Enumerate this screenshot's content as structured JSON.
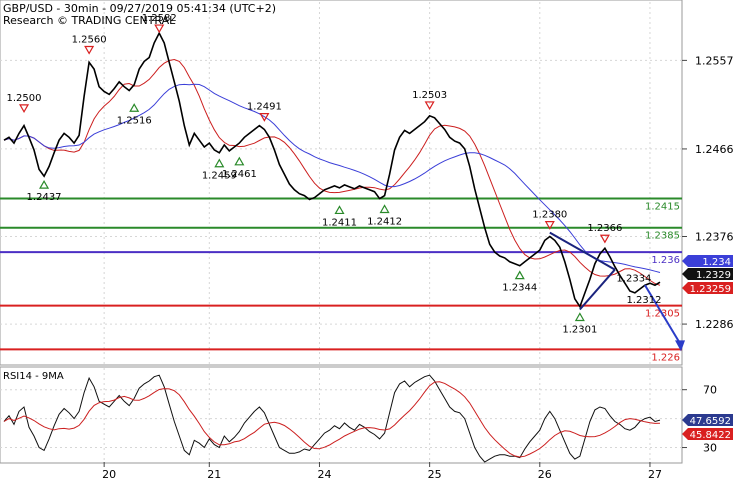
{
  "header": {
    "line1": "GBP/USD - 30min - 09/27/2019 05:41:34 (UTC+2)",
    "line2": "Research © TRADING CENTRAL"
  },
  "chart_data": [
    {
      "type": "line",
      "panel": "price",
      "title": "GBP/USD - 30min - 09/27/2019 05:41:34 (UTC+2)",
      "subtitle": "Research © TRADING CENTRAL",
      "x_ticks": [
        "20",
        "21",
        "24",
        "25",
        "26",
        "27"
      ],
      "y_ticks": [
        1.2557,
        1.2466,
        1.2376,
        1.2286
      ],
      "ylim": [
        1.2246,
        1.2617
      ],
      "grid": true,
      "price_series": [
        1.2475,
        1.2478,
        1.2472,
        1.2482,
        1.249,
        1.2478,
        1.2465,
        1.2445,
        1.2438,
        1.2448,
        1.2462,
        1.2475,
        1.2482,
        1.2478,
        1.2472,
        1.248,
        1.252,
        1.2555,
        1.2548,
        1.253,
        1.2525,
        1.2522,
        1.2528,
        1.2535,
        1.253,
        1.2526,
        1.2532,
        1.2548,
        1.2556,
        1.256,
        1.2575,
        1.2585,
        1.2575,
        1.2555,
        1.2535,
        1.2515,
        1.249,
        1.247,
        1.2482,
        1.2475,
        1.2468,
        1.2472,
        1.2465,
        1.2462,
        1.247,
        1.2464,
        1.2468,
        1.2472,
        1.2478,
        1.2482,
        1.2486,
        1.249,
        1.2486,
        1.2478,
        1.2465,
        1.245,
        1.244,
        1.243,
        1.2424,
        1.242,
        1.2418,
        1.2414,
        1.2416,
        1.242,
        1.2424,
        1.2426,
        1.2428,
        1.2426,
        1.2429,
        1.2427,
        1.2425,
        1.2428,
        1.2426,
        1.2424,
        1.2422,
        1.2415,
        1.2418,
        1.244,
        1.2465,
        1.2478,
        1.2485,
        1.2482,
        1.2486,
        1.249,
        1.2494,
        1.25,
        1.2498,
        1.2492,
        1.2486,
        1.2478,
        1.2474,
        1.2472,
        1.2466,
        1.2448,
        1.2425,
        1.2405,
        1.2385,
        1.2368,
        1.236,
        1.2356,
        1.2354,
        1.235,
        1.2348,
        1.2346,
        1.235,
        1.2354,
        1.2358,
        1.2362,
        1.2372,
        1.2376,
        1.2372,
        1.2365,
        1.235,
        1.2332,
        1.2312,
        1.2304,
        1.2318,
        1.2332,
        1.2348,
        1.2358,
        1.2364,
        1.2355,
        1.2345,
        1.2336,
        1.2328,
        1.232,
        1.2318,
        1.2322,
        1.2326,
        1.2328,
        1.2326,
        1.2329
      ],
      "moving_averages": [
        {
          "name": "fast",
          "color": "#cc1f1f",
          "period": 9
        },
        {
          "name": "slow",
          "color": "#3b3fd8",
          "period": 24
        }
      ],
      "price_labels": [
        {
          "text": "1.2500",
          "value": 1.25,
          "index": 4,
          "marker": "resistance"
        },
        {
          "text": "1.2437",
          "value": 1.2437,
          "index": 8,
          "marker": "support"
        },
        {
          "text": "1.2560",
          "value": 1.256,
          "index": 17,
          "marker": "resistance"
        },
        {
          "text": "1.2516",
          "value": 1.2516,
          "index": 26,
          "marker": "support"
        },
        {
          "text": "1.2582",
          "value": 1.2582,
          "index": 31,
          "marker": "resistance"
        },
        {
          "text": "1.2459",
          "value": 1.2459,
          "index": 43,
          "marker": "support"
        },
        {
          "text": "1.2461",
          "value": 1.2461,
          "index": 47,
          "marker": "support"
        },
        {
          "text": "1.2491",
          "value": 1.2491,
          "index": 52,
          "marker": "resistance"
        },
        {
          "text": "1.2411",
          "value": 1.2411,
          "index": 67,
          "marker": "support"
        },
        {
          "text": "1.2412",
          "value": 1.2412,
          "index": 76,
          "marker": "support"
        },
        {
          "text": "1.2503",
          "value": 1.2503,
          "index": 85,
          "marker": "resistance"
        },
        {
          "text": "1.2344",
          "value": 1.2344,
          "index": 103,
          "marker": "support"
        },
        {
          "text": "1.2380",
          "value": 1.238,
          "index": 109,
          "marker": "resistance"
        },
        {
          "text": "1.2301",
          "value": 1.2301,
          "index": 115,
          "marker": "support"
        },
        {
          "text": "1.2366",
          "value": 1.2366,
          "index": 120,
          "marker": "resistance"
        },
        {
          "text": "1.2334",
          "value": 1.2334,
          "index": 125,
          "marker": "none"
        },
        {
          "text": "1.2312",
          "value": 1.2312,
          "index": 127,
          "marker": "none"
        }
      ],
      "horizontal_lines": [
        {
          "value": 1.2415,
          "label": "1.2415",
          "color": "#2a8a2a"
        },
        {
          "value": 1.2385,
          "label": "1.2385",
          "color": "#2a8a2a"
        },
        {
          "value": 1.236,
          "label": "1.236",
          "color": "#4b2fc4"
        },
        {
          "value": 1.2305,
          "label": "1.2305",
          "color": "#d92020"
        },
        {
          "value": 1.226,
          "label": "1.226",
          "color": "#d92020"
        }
      ],
      "current_price_tags": [
        {
          "text": "1.234",
          "bg": "#3b3fd8",
          "fg": "#ffffff"
        },
        {
          "text": "1.2329",
          "bg": "#111111",
          "fg": "#ffffff"
        },
        {
          "text": "1.23259",
          "bg": "#d92020",
          "fg": "#ffffff"
        }
      ],
      "triangle_pattern": {
        "upper": [
          [
            109,
            1.238
          ],
          [
            122,
            1.2342
          ]
        ],
        "lower": [
          [
            115,
            1.2301
          ],
          [
            122,
            1.2342
          ]
        ]
      },
      "forecast_arrow": {
        "from": [
          128,
          1.2326
        ],
        "to": [
          135,
          1.226
        ],
        "color": "#2a3cc8"
      }
    },
    {
      "type": "line",
      "panel": "oscillator",
      "title": "RSI14 - 9MA",
      "ylim": [
        20,
        85
      ],
      "y_ticks": [
        70,
        30
      ],
      "series": [
        {
          "name": "RSI14",
          "color": "#111111",
          "values": [
            48,
            52,
            46,
            55,
            58,
            44,
            38,
            30,
            28,
            36,
            45,
            53,
            57,
            54,
            50,
            55,
            68,
            78,
            72,
            62,
            60,
            58,
            62,
            66,
            62,
            59,
            64,
            71,
            74,
            76,
            79,
            80,
            72,
            60,
            48,
            38,
            28,
            25,
            35,
            33,
            30,
            36,
            32,
            30,
            38,
            34,
            37,
            41,
            47,
            51,
            55,
            58,
            54,
            46,
            38,
            30,
            28,
            26,
            26,
            27,
            29,
            28,
            32,
            36,
            40,
            42,
            45,
            43,
            47,
            44,
            42,
            46,
            44,
            41,
            39,
            36,
            40,
            54,
            68,
            74,
            76,
            72,
            75,
            77,
            79,
            80,
            76,
            70,
            64,
            58,
            55,
            54,
            50,
            40,
            30,
            24,
            20,
            22,
            24,
            25,
            25,
            24,
            24,
            23,
            29,
            34,
            38,
            42,
            50,
            55,
            50,
            42,
            34,
            26,
            22,
            24,
            36,
            48,
            56,
            58,
            57,
            52,
            48,
            46,
            43,
            42,
            44,
            48,
            50,
            51,
            48,
            49
          ]
        },
        {
          "name": "9MA",
          "color": "#cc1f1f",
          "values": []
        }
      ],
      "value_tags": [
        {
          "text": "47.6592",
          "bg": "#2b3a8f",
          "fg": "#ffffff"
        },
        {
          "text": "45.8422",
          "bg": "#d92020",
          "fg": "#ffffff"
        }
      ]
    }
  ]
}
